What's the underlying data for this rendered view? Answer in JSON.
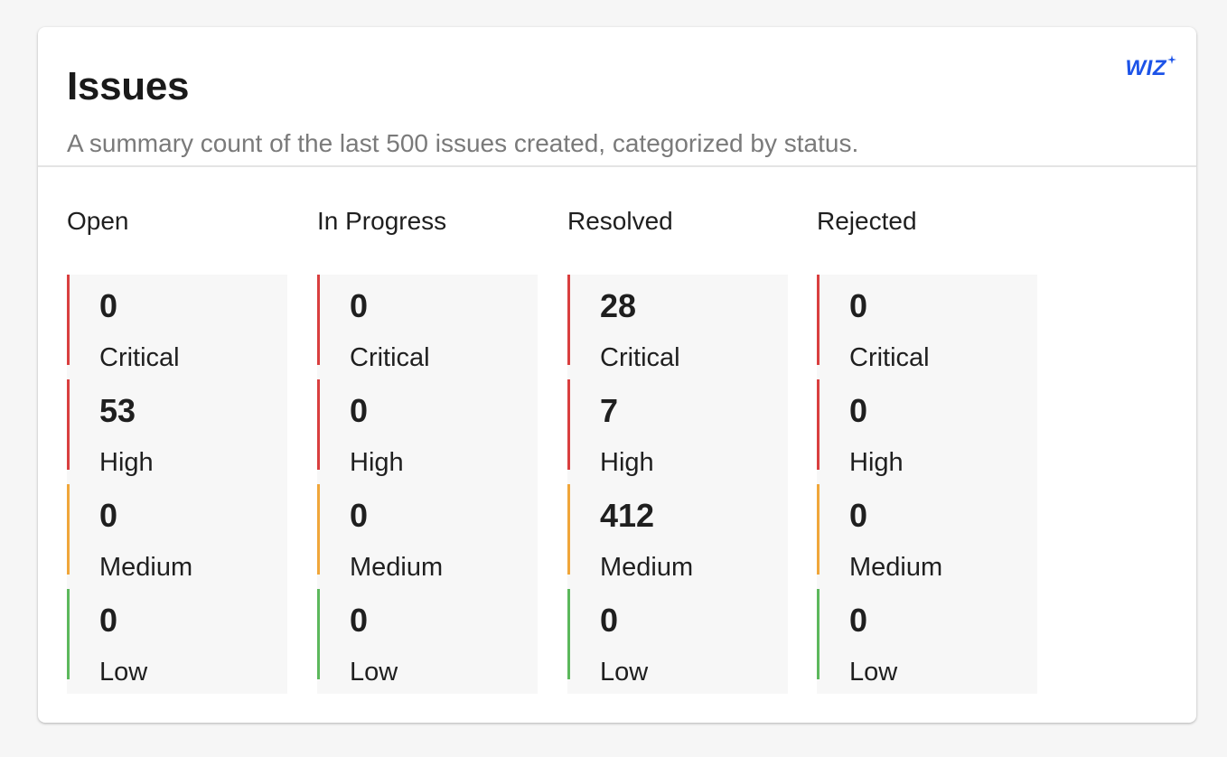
{
  "card": {
    "title": "Issues",
    "subtitle": "A summary count of the last 500 issues created, categorized by status.",
    "logo": {
      "text": "WIZ",
      "icon": "sparkle-icon",
      "color": "#1c53e8"
    }
  },
  "severity_colors": {
    "critical": "#d93f3f",
    "high": "#d93f3f",
    "medium": "#f0a63a",
    "low": "#5cb85c"
  },
  "statuses": [
    {
      "label": "Open",
      "counts": [
        {
          "severity": "Critical",
          "count": "0",
          "color": "#d93f3f"
        },
        {
          "severity": "High",
          "count": "53",
          "color": "#d93f3f"
        },
        {
          "severity": "Medium",
          "count": "0",
          "color": "#f0a63a"
        },
        {
          "severity": "Low",
          "count": "0",
          "color": "#5cb85c"
        }
      ]
    },
    {
      "label": "In Progress",
      "counts": [
        {
          "severity": "Critical",
          "count": "0",
          "color": "#d93f3f"
        },
        {
          "severity": "High",
          "count": "0",
          "color": "#d93f3f"
        },
        {
          "severity": "Medium",
          "count": "0",
          "color": "#f0a63a"
        },
        {
          "severity": "Low",
          "count": "0",
          "color": "#5cb85c"
        }
      ]
    },
    {
      "label": "Resolved",
      "counts": [
        {
          "severity": "Critical",
          "count": "28",
          "color": "#d93f3f"
        },
        {
          "severity": "High",
          "count": "7",
          "color": "#d93f3f"
        },
        {
          "severity": "Medium",
          "count": "412",
          "color": "#f0a63a"
        },
        {
          "severity": "Low",
          "count": "0",
          "color": "#5cb85c"
        }
      ]
    },
    {
      "label": "Rejected",
      "counts": [
        {
          "severity": "Critical",
          "count": "0",
          "color": "#d93f3f"
        },
        {
          "severity": "High",
          "count": "0",
          "color": "#d93f3f"
        },
        {
          "severity": "Medium",
          "count": "0",
          "color": "#f0a63a"
        },
        {
          "severity": "Low",
          "count": "0",
          "color": "#5cb85c"
        }
      ]
    }
  ]
}
